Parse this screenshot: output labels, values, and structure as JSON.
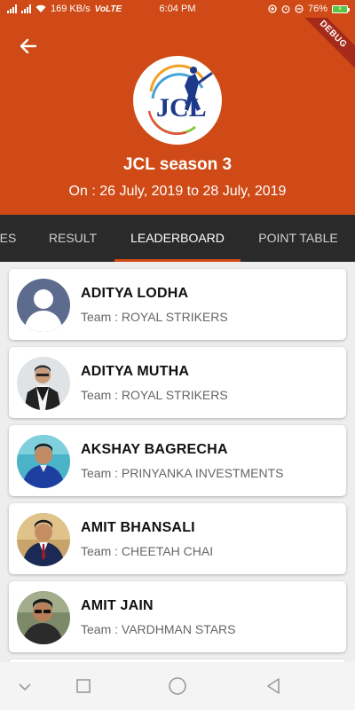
{
  "status_bar": {
    "network_speed": "169 KB/s",
    "volte": "VoLTE",
    "time": "6:04 PM",
    "battery": "76%"
  },
  "header": {
    "debug_label": "DEBUG",
    "logo_text": "JCL",
    "title": "JCL season 3",
    "dates": "On : 26 July, 2019 to 28 July, 2019",
    "background_color": "#cf4a16"
  },
  "tabs": [
    {
      "label": "ES"
    },
    {
      "label": "RESULT"
    },
    {
      "label": "LEADERBOARD"
    },
    {
      "label": "POINT TABLE"
    }
  ],
  "active_tab": "LEADERBOARD",
  "players": [
    {
      "name": "ADITYA LODHA",
      "team": "Team : ROYAL STRIKERS",
      "avatar": "default-avatar"
    },
    {
      "name": "ADITYA MUTHA",
      "team": "Team : ROYAL STRIKERS",
      "avatar": "photo"
    },
    {
      "name": "AKSHAY BAGRECHA",
      "team": "Team : PRINYANKA INVESTMENTS",
      "avatar": "photo"
    },
    {
      "name": "AMIT BHANSALI",
      "team": "Team : CHEETAH CHAI",
      "avatar": "photo"
    },
    {
      "name": "AMIT JAIN",
      "team": "Team : VARDHMAN STARS",
      "avatar": "photo"
    }
  ],
  "nav_bar": {
    "icons": [
      "chevron-down-icon",
      "square-icon",
      "circle-icon",
      "triangle-back-icon"
    ]
  }
}
